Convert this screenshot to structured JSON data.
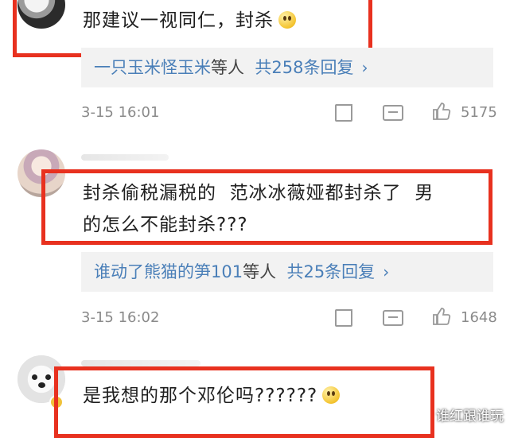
{
  "comments": [
    {
      "text": "那建议一视同仁，封杀",
      "reply": {
        "users": "一只玉米怪玉米",
        "suffix": "等人",
        "count": "共258条回复"
      },
      "time": "3-15 16:01",
      "likes": "5175"
    },
    {
      "text_line1": "封杀偷税漏税的  范冰冰薇娅都封杀了  男",
      "text_line2": "的怎么不能封杀???",
      "reply": {
        "users": "谁动了熊猫的笋101",
        "suffix": "等人",
        "count": "共25条回复"
      },
      "time": "3-15 16:02",
      "likes": "1648"
    },
    {
      "text": "是我想的那个邓伦吗??????"
    }
  ],
  "watermark": "谁红跟谁玩",
  "icons": {
    "share": "share-icon",
    "comment": "comment-icon",
    "like": "thumbs-up-icon",
    "arrow": "chevron-right-icon"
  },
  "colors": {
    "highlight": "#e8311f",
    "link": "#4a7fb8",
    "meta": "#8a8a8a"
  }
}
